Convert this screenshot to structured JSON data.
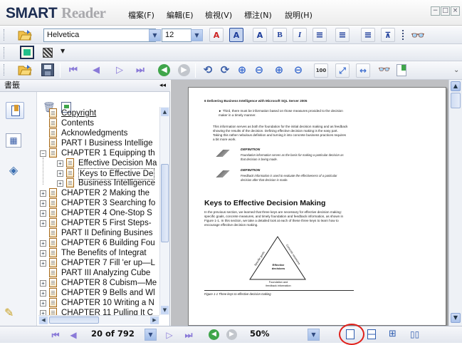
{
  "app": {
    "title_main": "SMART",
    "title_sub": "Reader"
  },
  "menu": [
    "檔案(F)",
    "編輯(E)",
    "檢視(V)",
    "標注(N)",
    "說明(H)"
  ],
  "window_controls": [
    "−",
    "□",
    "×"
  ],
  "format_toolbar": {
    "font": "Helvetica",
    "size": "12"
  },
  "sidebar": {
    "title": "書籤",
    "close": "◂◂",
    "tree": [
      {
        "label": "Copyright",
        "link": true
      },
      {
        "label": "Contents"
      },
      {
        "label": "Acknowledgments"
      },
      {
        "label": "PART I Business Intellige"
      },
      {
        "label": "CHAPTER 1 Equipping th",
        "expander": "−"
      },
      {
        "label": "Effective Decision Ma",
        "expander": "+",
        "indent": true
      },
      {
        "label": "Keys to Effective De",
        "expander": "+",
        "indent": true,
        "selected": true
      },
      {
        "label": "Business Intelligence",
        "expander": "+",
        "indent": true
      },
      {
        "label": "CHAPTER 2 Making the",
        "expander": "+"
      },
      {
        "label": "CHAPTER 3 Searching fo",
        "expander": "+"
      },
      {
        "label": "CHAPTER 4 One-Stop S",
        "expander": "+"
      },
      {
        "label": "CHAPTER 5 First Steps-",
        "expander": "+"
      },
      {
        "label": "PART II Defining Busines"
      },
      {
        "label": "CHAPTER 6 Building Fou",
        "expander": "+"
      },
      {
        "label": "The Benefits of Integrat",
        "expander": "+"
      },
      {
        "label": "CHAPTER 7 Fill 'er up—L",
        "expander": "+"
      },
      {
        "label": "PART III Analyzing Cube"
      },
      {
        "label": "CHAPTER 8 Cubism—Me",
        "expander": "+"
      },
      {
        "label": "CHAPTER 9 Bells and Wl",
        "expander": "+"
      },
      {
        "label": "CHAPTER 10 Writing a N",
        "expander": "+"
      },
      {
        "label": "CHAPTER 11 Pulling It C",
        "expander": "+"
      }
    ]
  },
  "document": {
    "header": "6   Delivering Business Intelligence with Microsoft SQL Server 2005",
    "bullet": "Third, there must be information based on those measures provided to the decision maker in a timely manner.",
    "para1": "This information serves as both the foundation for the initial decision making and as feedback showing the results of the decision. Defining effective decision making is the easy part. Taking this rather nebulous definition and turning it into concrete business practices requires a bit more work.",
    "def1_title": "DEFINITION",
    "def1_text": "Foundation information serves as the basis for making a particular decision as that decision is being made.",
    "def2_title": "DEFINITION",
    "def2_text": "Feedback information is used to evaluate the effectiveness of a particular decision after that decision is made.",
    "heading": "Keys to Effective Decision Making",
    "para2": "In the previous section, we learned that three keys are necessary for effective decision making: specific goals, concrete measures, and timely foundation and feedback information, as shown in Figure 1-1. In this section, we take a detailed look at each of these three keys to learn how to encourage effective decision making.",
    "triangle_center": "Effective decisions",
    "triangle_left": "Specific goals",
    "triangle_right": "Concrete measures",
    "triangle_base": "Foundation and feedback information",
    "caption": "Figure 1-1   Three keys to effective decision making"
  },
  "status": {
    "page": "20 of 792",
    "zoom": "50%"
  }
}
